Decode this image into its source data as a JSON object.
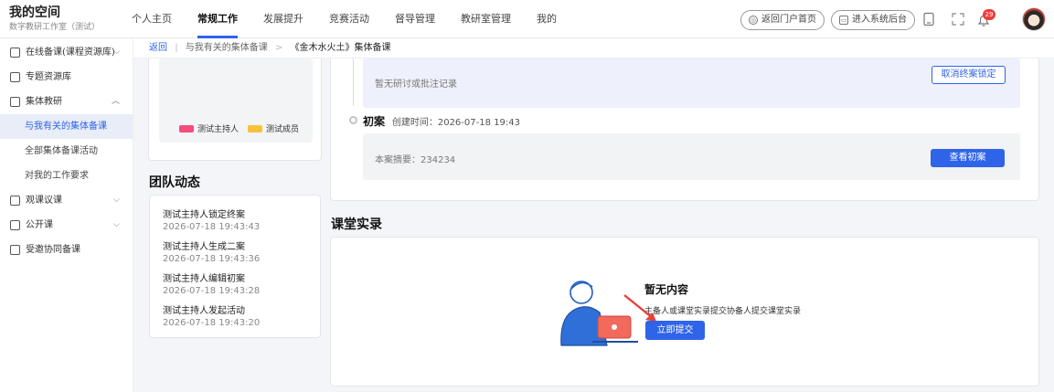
{
  "brand": {
    "title": "我的空间",
    "subtitle": "数字教研工作室（测试）"
  },
  "nav": [
    "个人主页",
    "常规工作",
    "发展提升",
    "竞赛活动",
    "督导管理",
    "教研室管理",
    "我的"
  ],
  "nav_active": "常规工作",
  "header": {
    "portal_button": "返回门户首页",
    "admin_button": "进入系统后台",
    "notification_count": "29"
  },
  "sidebar": {
    "items": [
      {
        "label": "在线备课(课程资源库)",
        "icon": "document-icon"
      },
      {
        "label": "专题资源库",
        "icon": "folder-icon"
      },
      {
        "label": "集体教研",
        "icon": "list-icon"
      },
      {
        "label": "观课议课",
        "icon": "video-icon"
      },
      {
        "label": "公开课",
        "icon": "play-icon"
      },
      {
        "label": "受邀协同备课",
        "icon": "group-icon"
      }
    ],
    "subitems": [
      "与我有关的集体备课",
      "全部集体备课活动",
      "对我的工作要求"
    ]
  },
  "breadcrumb": {
    "back": "返回",
    "middle": "与我有关的集体备课",
    "current": "《金木水火土》集体备课"
  },
  "legend": [
    {
      "label": "测试主持人",
      "color": "#f54c7c"
    },
    {
      "label": "测试成员",
      "color": "#f7c23b"
    }
  ],
  "team": {
    "title": "团队动态",
    "items": [
      {
        "text": "测试主持人锁定终案",
        "time": "2026-07-18 19:43:43"
      },
      {
        "text": "测试主持人生成二案",
        "time": "2026-07-18 19:43:36"
      },
      {
        "text": "测试主持人编辑初案",
        "time": "2026-07-18 19:43:28"
      },
      {
        "text": "测试主持人发起活动",
        "time": "2026-07-18 19:43:20"
      }
    ]
  },
  "timeline": {
    "no_record": "暂无研讨或批注记录",
    "cancel_lock_button": "取消终案锁定",
    "first_draft_title": "初案",
    "created_label": "创建时间：2026-07-18  19:43",
    "summary_label": "本案摘要：234234",
    "view_draft_button": "查看初案"
  },
  "classroom": {
    "title": "课堂实录",
    "empty_title": "暂无内容",
    "empty_desc": "主备人或课堂实录提交协备人提交课堂实录",
    "submit_button": "立即提交"
  },
  "colors": {
    "accent": "#2f64e8",
    "donut": "#f54c7c",
    "arrow": "#e8403a"
  }
}
